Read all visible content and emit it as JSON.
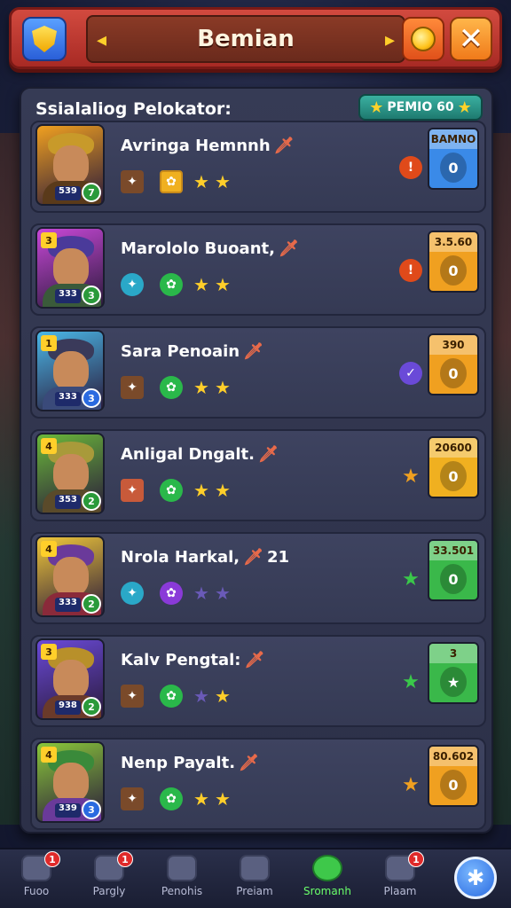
{
  "header": {
    "title": "Bemian",
    "arrow_left": "◂",
    "arrow_right": "▸",
    "close": "✕"
  },
  "panel": {
    "heading": "Ssialaliog Pelokator:",
    "badge": "PEMIO 60"
  },
  "heroes": [
    {
      "name": "Avringa Hemnnh",
      "level": "",
      "power": "539",
      "rank": "7",
      "rank_color": "#2a9a3a",
      "bg": "#f0a020",
      "helm": "#c89a2a",
      "body": "#5a3a1a",
      "status_color": "#e04a1a",
      "status": "!",
      "reward_price": "BAMNO",
      "reward_color": "#3a8ae8",
      "reward_slot": "0",
      "stars_on": 2,
      "stars_off": 0,
      "icon1": "sq",
      "icon1_color": "#7a4a2a",
      "icon2": "sq",
      "icon2_color": "#f0b020"
    },
    {
      "name": "Marololo Buoant,",
      "level": "3",
      "power": "333",
      "rank": "3",
      "rank_color": "#2a9a3a",
      "bg": "#c848d8",
      "helm": "#4a3a9a",
      "body": "#3a5a3a",
      "status_color": "#e04a1a",
      "status": "!",
      "reward_price": "3.5.60",
      "reward_color": "#f0a020",
      "reward_slot": "0",
      "stars_on": 2,
      "stars_off": 0,
      "icon1": "round",
      "icon1_color": "#2aa8c8",
      "icon2": "round",
      "icon2_color": "#2ab84a"
    },
    {
      "name": "Sara Penoain",
      "level": "1",
      "power": "333",
      "rank": "3",
      "rank_color": "#2a6ae0",
      "bg": "#4ab8e8",
      "helm": "#3a3a5a",
      "body": "#3a4a7a",
      "status_color": "#6a4ad8",
      "status": "✓",
      "reward_price": "390",
      "reward_color": "#f0a020",
      "reward_slot": "0",
      "stars_on": 2,
      "stars_off": 0,
      "icon1": "sq",
      "icon1_color": "#7a4a2a",
      "icon2": "round",
      "icon2_color": "#2ab84a"
    },
    {
      "name": "Anligal Dngalt.",
      "level": "4",
      "power": "353",
      "rank": "2",
      "rank_color": "#2a9a3a",
      "bg": "#6ab83a",
      "helm": "#a89a3a",
      "body": "#5a4a2a",
      "status_color": "#f0a020",
      "status": "★",
      "reward_price": "20600",
      "reward_color": "#f0b020",
      "reward_slot": "0",
      "stars_on": 2,
      "stars_off": 0,
      "icon1": "sq",
      "icon1_color": "#c85a3a",
      "icon2": "round",
      "icon2_color": "#2ab84a"
    },
    {
      "name": "Nrola Harkal,",
      "level": "4",
      "power": "333",
      "rank": "2",
      "rank_color": "#2a9a3a",
      "bg": "#f0c83a",
      "helm": "#6a3a9a",
      "body": "#8a2a3a",
      "status_color": "#3ac84a",
      "status": "★",
      "reward_price": "33.501",
      "reward_color": "#3ab84a",
      "reward_slot": "0",
      "stars_on": 0,
      "stars_off": 2,
      "icon1": "round",
      "icon1_color": "#2aa8c8",
      "icon2": "round",
      "icon2_color": "#8a3ad8",
      "extra": "21"
    },
    {
      "name": "Kalv Pengtal:",
      "level": "3",
      "power": "938",
      "rank": "2",
      "rank_color": "#2a9a3a",
      "bg": "#6a4ad8",
      "helm": "#b8902a",
      "body": "#6a3a2a",
      "status_color": "#3ac84a",
      "status": "★",
      "reward_price": "3",
      "reward_color": "#3ab84a",
      "reward_slot": "★",
      "stars_on": 0,
      "stars_off": 1,
      "icon1": "sq",
      "icon1_color": "#7a4a2a",
      "icon2": "round",
      "icon2_color": "#2ab84a",
      "star_mix": true
    },
    {
      "name": "Nenp Payalt.",
      "level": "4",
      "power": "339",
      "rank": "3",
      "rank_color": "#2a6ae0",
      "bg": "#8ac83a",
      "helm": "#3a8a3a",
      "body": "#6a3a9a",
      "status_color": "#f0a020",
      "status": "★",
      "reward_price": "80.602",
      "reward_color": "#f0a020",
      "reward_slot": "0",
      "stars_on": 2,
      "stars_off": 0,
      "icon1": "sq",
      "icon1_color": "#7a4a2a",
      "icon2": "round",
      "icon2_color": "#2ab84a"
    }
  ],
  "nav": [
    {
      "label": "Fuoo",
      "badge": "1"
    },
    {
      "label": "Pargly",
      "badge": "1"
    },
    {
      "label": "Penohis",
      "badge": ""
    },
    {
      "label": "Preiam",
      "badge": ""
    },
    {
      "label": "Sromanh",
      "badge": "",
      "active": true
    },
    {
      "label": "Plaam",
      "badge": "1"
    }
  ],
  "nav_plus": "✱"
}
